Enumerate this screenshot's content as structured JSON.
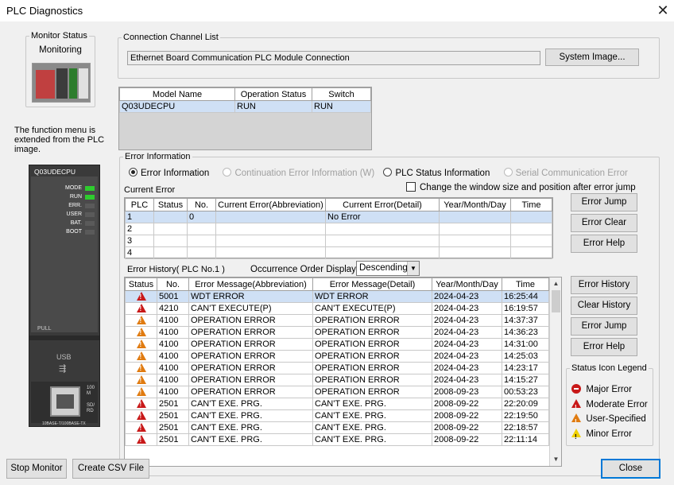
{
  "window": {
    "title": "PLC Diagnostics",
    "close_glyph": "✕"
  },
  "monitor": {
    "group_label": "Monitor Status",
    "status": "Monitoring"
  },
  "note": "The function menu is extended from the PLC image.",
  "plc_image": {
    "model": "Q03UDECPU",
    "leds": [
      {
        "label": "MODE",
        "on": true
      },
      {
        "label": "RUN",
        "on": true
      },
      {
        "label": "ERR.",
        "on": false
      },
      {
        "label": "USER",
        "on": false
      },
      {
        "label": "BAT.",
        "on": false
      },
      {
        "label": "BOOT",
        "on": false
      }
    ],
    "pull": "PULL",
    "usb": "USB",
    "port_label": "10BASE-T/100BASE-TX",
    "side_labels": [
      "100",
      "M",
      "SD/",
      "RD"
    ]
  },
  "connection": {
    "group_label": "Connection Channel List",
    "value": "Ethernet Board Communication PLC Module Connection",
    "system_image_button": "System Image..."
  },
  "model_table": {
    "headers": [
      "Model Name",
      "Operation Status",
      "Switch"
    ],
    "rows": [
      [
        "Q03UDECPU",
        "RUN",
        "RUN"
      ]
    ]
  },
  "error_info": {
    "group_label": "Error Information",
    "radios": [
      {
        "label": "Error Information",
        "checked": true,
        "enabled": true
      },
      {
        "label": "Continuation Error Information (W)",
        "checked": false,
        "enabled": false
      },
      {
        "label": "PLC Status Information",
        "checked": false,
        "enabled": true
      },
      {
        "label": "Serial Communication Error",
        "checked": false,
        "enabled": false
      }
    ],
    "current_error_label": "Current Error",
    "checkbox_label": "Change the window size and position after error jump",
    "current_headers": [
      "PLC",
      "Status",
      "No.",
      "Current Error(Abbreviation)",
      "Current Error(Detail)",
      "Year/Month/Day",
      "Time"
    ],
    "current_rows": [
      [
        "1",
        "",
        "0",
        "",
        "No Error",
        "",
        ""
      ],
      [
        "2",
        "",
        "",
        "",
        "",
        "",
        ""
      ],
      [
        "3",
        "",
        "",
        "",
        "",
        "",
        ""
      ],
      [
        "4",
        "",
        "",
        "",
        "",
        "",
        ""
      ]
    ],
    "buttons_current": [
      "Error Jump",
      "Error Clear",
      "Error Help"
    ],
    "history_label": "Error History( PLC No.1 )",
    "order_label": "Occurrence Order Display",
    "order_value": "Descending",
    "history_headers": [
      "Status",
      "No.",
      "Error Message(Abbreviation)",
      "Error Message(Detail)",
      "Year/Month/Day",
      "Time"
    ],
    "history_rows": [
      {
        "icon": "major-error-icon",
        "no": "5001",
        "abbr": "WDT ERROR",
        "detail": "WDT ERROR",
        "date": "2024-04-23",
        "time": "16:25:44"
      },
      {
        "icon": "major-error-icon",
        "no": "4210",
        "abbr": "CAN'T EXECUTE(P)",
        "detail": "CAN'T EXECUTE(P)",
        "date": "2024-04-23",
        "time": "16:19:57"
      },
      {
        "icon": "moderate-error-icon",
        "no": "4100",
        "abbr": "OPERATION ERROR",
        "detail": "OPERATION ERROR",
        "date": "2024-04-23",
        "time": "14:37:37"
      },
      {
        "icon": "moderate-error-icon",
        "no": "4100",
        "abbr": "OPERATION ERROR",
        "detail": "OPERATION ERROR",
        "date": "2024-04-23",
        "time": "14:36:23"
      },
      {
        "icon": "moderate-error-icon",
        "no": "4100",
        "abbr": "OPERATION ERROR",
        "detail": "OPERATION ERROR",
        "date": "2024-04-23",
        "time": "14:31:00"
      },
      {
        "icon": "moderate-error-icon",
        "no": "4100",
        "abbr": "OPERATION ERROR",
        "detail": "OPERATION ERROR",
        "date": "2024-04-23",
        "time": "14:25:03"
      },
      {
        "icon": "moderate-error-icon",
        "no": "4100",
        "abbr": "OPERATION ERROR",
        "detail": "OPERATION ERROR",
        "date": "2024-04-23",
        "time": "14:23:17"
      },
      {
        "icon": "moderate-error-icon",
        "no": "4100",
        "abbr": "OPERATION ERROR",
        "detail": "OPERATION ERROR",
        "date": "2024-04-23",
        "time": "14:15:27"
      },
      {
        "icon": "moderate-error-icon",
        "no": "4100",
        "abbr": "OPERATION ERROR",
        "detail": "OPERATION ERROR",
        "date": "2008-09-23",
        "time": "00:53:23"
      },
      {
        "icon": "major-error-icon",
        "no": "2501",
        "abbr": "CAN'T EXE. PRG.",
        "detail": "CAN'T EXE. PRG.",
        "date": "2008-09-22",
        "time": "22:20:09"
      },
      {
        "icon": "major-error-icon",
        "no": "2501",
        "abbr": "CAN'T EXE. PRG.",
        "detail": "CAN'T EXE. PRG.",
        "date": "2008-09-22",
        "time": "22:19:50"
      },
      {
        "icon": "major-error-icon",
        "no": "2501",
        "abbr": "CAN'T EXE. PRG.",
        "detail": "CAN'T EXE. PRG.",
        "date": "2008-09-22",
        "time": "22:18:57"
      },
      {
        "icon": "major-error-icon",
        "no": "2501",
        "abbr": "CAN'T EXE. PRG.",
        "detail": "CAN'T EXE. PRG.",
        "date": "2008-09-22",
        "time": "22:11:14"
      }
    ],
    "buttons_history": [
      "Error History",
      "Clear History",
      "Error Jump",
      "Error Help"
    ],
    "legend": {
      "title": "Status Icon Legend",
      "items": [
        {
          "icon": "major-error-icon",
          "label": "Major Error"
        },
        {
          "icon": "moderate-error-icon",
          "label": "Moderate Error"
        },
        {
          "icon": "user-specified-icon",
          "label": "User-Specified"
        },
        {
          "icon": "minor-error-icon",
          "label": "Minor Error"
        }
      ]
    }
  },
  "footer": {
    "stop_monitor": "Stop Monitor",
    "create_csv": "Create CSV File",
    "close": "Close"
  },
  "colors": {
    "selection": "#cfe0f5",
    "major": "#c81818",
    "moderate": "#e07b10",
    "minor": "#f0d000",
    "led_on": "#2ecc2e"
  }
}
